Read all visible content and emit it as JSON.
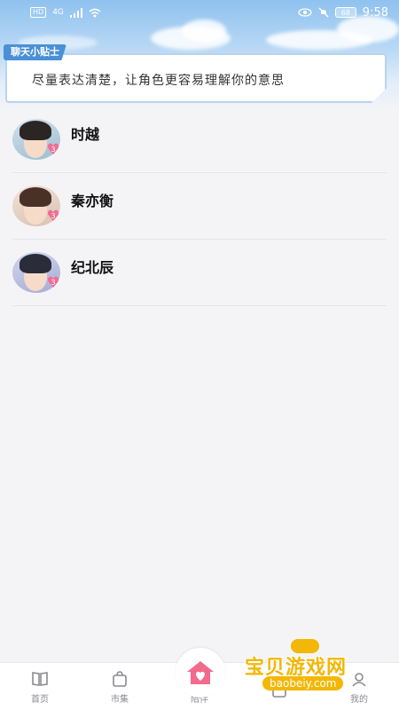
{
  "status_bar": {
    "left_chip": "HD",
    "signal_label": "4G",
    "battery": "68",
    "time": "9:58"
  },
  "tip": {
    "badge": "聊天小贴士",
    "text": "尽量表达清楚，让角色更容易理解你的意思"
  },
  "characters": [
    {
      "name": "时越",
      "level": "3"
    },
    {
      "name": "秦亦衡",
      "level": "3"
    },
    {
      "name": "纪北辰",
      "level": "3"
    }
  ],
  "nav": {
    "items": [
      {
        "label": "首页",
        "icon": "book-icon"
      },
      {
        "label": "市集",
        "icon": "shopping-bag-icon"
      },
      {
        "label": "陪伴",
        "icon": "home-heart-icon"
      },
      {
        "label": "",
        "icon": "message-icon"
      },
      {
        "label": "我的",
        "icon": "profile-icon"
      }
    ]
  },
  "watermark": {
    "title": "宝贝游戏网",
    "url": "baobeiy.com"
  },
  "colors": {
    "accent_blue": "#4a90d6",
    "heart_pink": "#f06d94",
    "watermark_yellow": "#f2b707"
  }
}
